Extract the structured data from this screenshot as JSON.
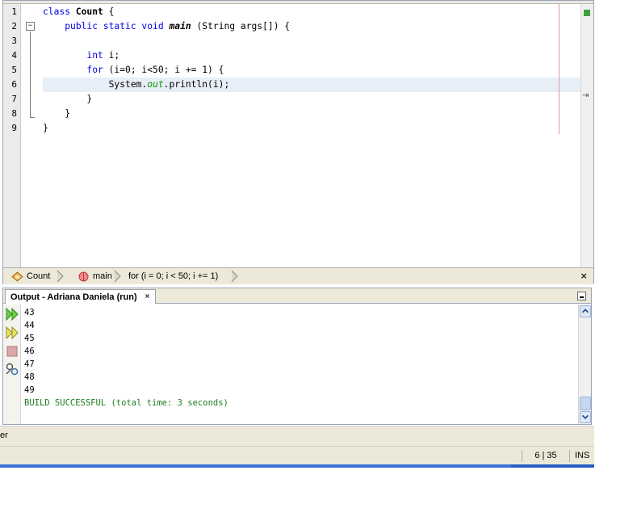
{
  "editor": {
    "line_numbers": [
      "1",
      "2",
      "3",
      "4",
      "5",
      "6",
      "7",
      "8",
      "9"
    ],
    "fold_button": "−",
    "code": {
      "l1": {
        "kw": "class",
        "name": "Count",
        "rest": " {"
      },
      "l2": {
        "indent": "    ",
        "kw": "public static void",
        "name": "main",
        "rest": " (String args[]) {"
      },
      "l4": {
        "indent": "        ",
        "kw": "int",
        "rest": " i;"
      },
      "l5": {
        "indent": "        ",
        "kw": "for",
        "rest": " (i=0; i<50; i += 1) {"
      },
      "l6": {
        "indent": "            ",
        "pre": "System.",
        "field": "out",
        "rest": ".println(i);"
      },
      "l7": {
        "text": "        }"
      },
      "l8": {
        "text": "    }"
      },
      "l9": {
        "text": "}"
      }
    },
    "right_arrow": "⇥"
  },
  "breadcrumb": {
    "items": [
      "Count",
      "main",
      "for (i = 0; i < 50; i += 1)"
    ],
    "close": "×"
  },
  "output": {
    "tab_title": "Output - Adriana Daniela (run)",
    "tab_close": "×",
    "lines": [
      "43",
      "44",
      "45",
      "46",
      "47",
      "48",
      "49"
    ],
    "build_message": "BUILD SUCCESSFUL (total time: 3 seconds)"
  },
  "lower_panel": {
    "label": "er"
  },
  "status": {
    "position": "6 | 35",
    "mode": "INS"
  },
  "colors": {
    "keyword": "#0000e6",
    "static_field": "#009900",
    "build_ok": "#1d7d1d",
    "current_line": "#e8eef8",
    "panel_bg": "#ece9d8"
  }
}
